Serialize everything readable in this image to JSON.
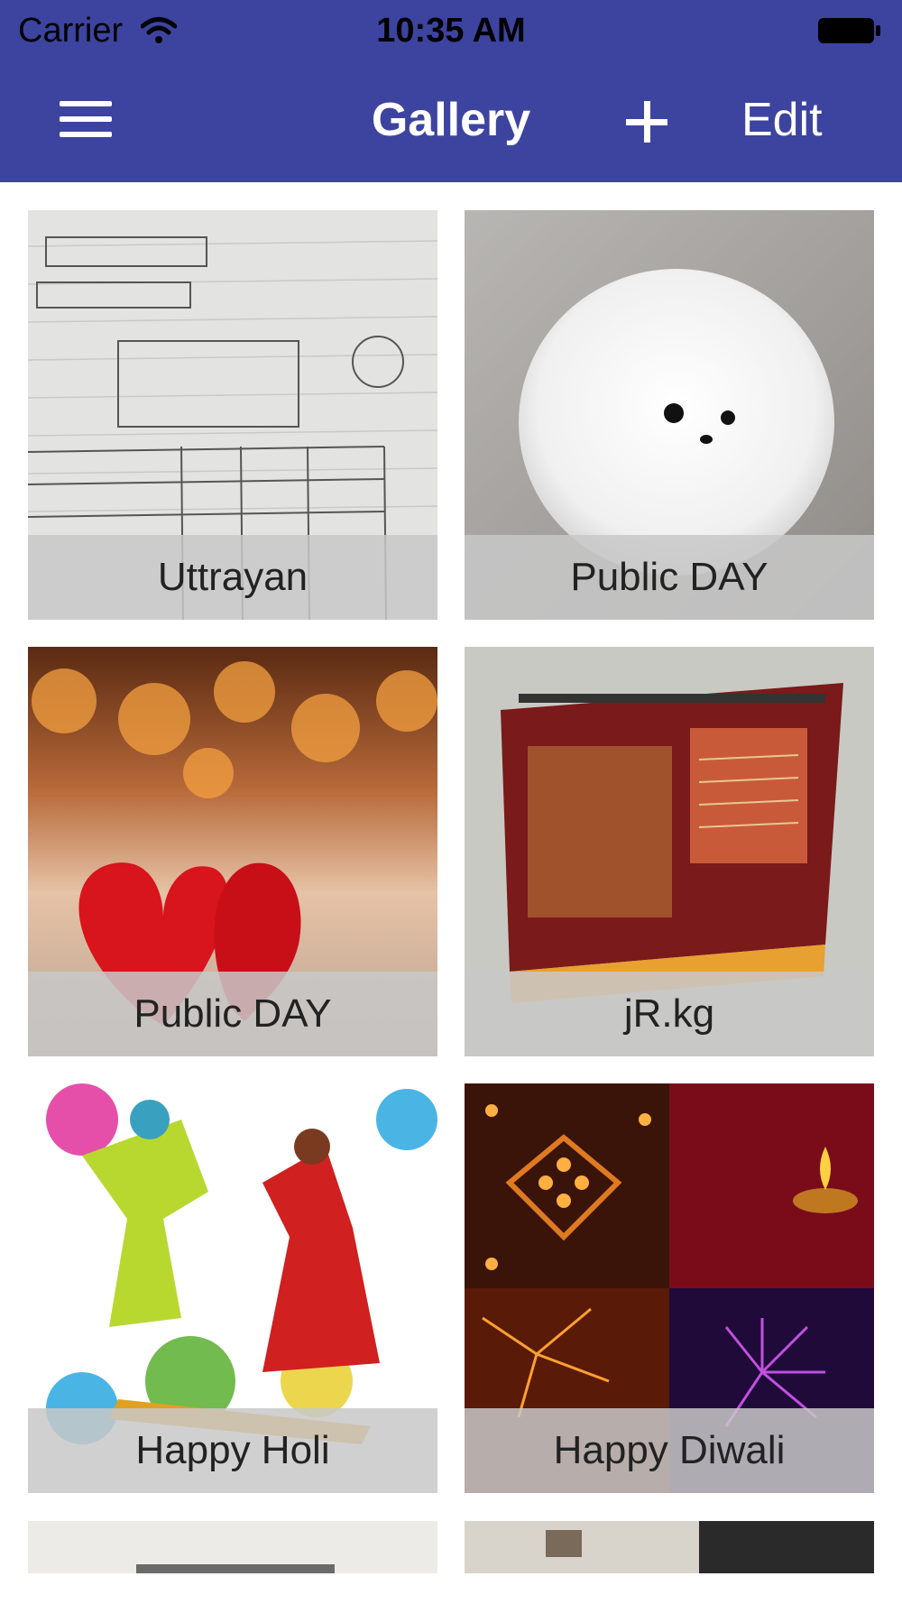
{
  "status_bar": {
    "carrier": "Carrier",
    "time": "10:35 AM",
    "wifi_icon": "wifi-icon",
    "battery_icon": "battery-icon"
  },
  "nav_bar": {
    "title": "Gallery",
    "menu_icon": "hamburger-menu-icon",
    "add_icon": "plus-icon",
    "edit_label": "Edit",
    "background_color": "#3c44a0"
  },
  "gallery": {
    "items": [
      {
        "caption": "Uttrayan",
        "image": "handwritten-notes-photo"
      },
      {
        "caption": "Public DAY",
        "image": "white-puppy-photo"
      },
      {
        "caption": "Public DAY",
        "image": "red-hearts-photo"
      },
      {
        "caption": "jR.kg",
        "image": "desk-calendar-photo"
      },
      {
        "caption": "Happy Holi",
        "image": "holi-dancers-illustration"
      },
      {
        "caption": "Happy Diwali",
        "image": "diwali-collage-photo"
      },
      {
        "caption": "",
        "image": "partial-photo"
      },
      {
        "caption": "",
        "image": "partial-photo"
      }
    ]
  }
}
